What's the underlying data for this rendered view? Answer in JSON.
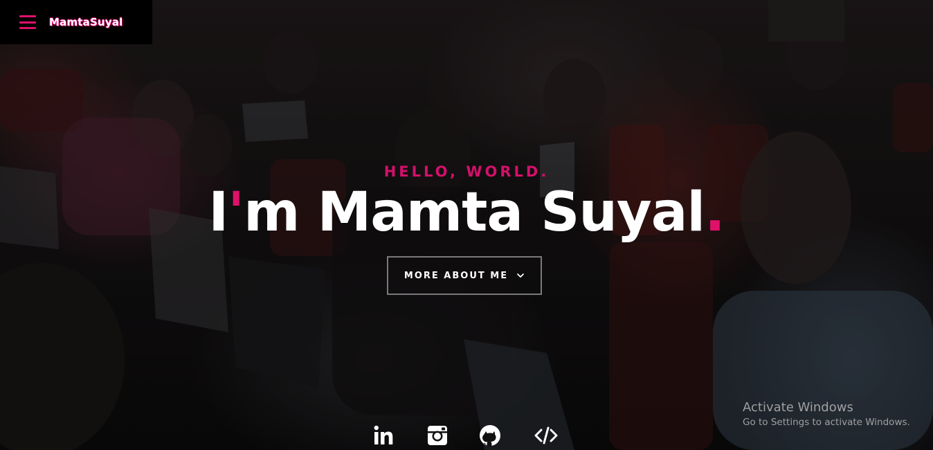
{
  "brand": {
    "name": "MamtaSuyal",
    "accent_color": "#e0116b"
  },
  "menu": {
    "icon": "hamburger-menu-icon"
  },
  "hero": {
    "greeting": "HELLO, WORLD.",
    "headline_prefix_i": "I",
    "headline_apostrophe": "'",
    "headline_rest": "m Mamta Suyal",
    "headline_period": ".",
    "cta_label": "MORE ABOUT ME",
    "cta_icon": "chevron-down-icon"
  },
  "social": [
    {
      "name": "linkedin",
      "icon": "linkedin-icon"
    },
    {
      "name": "instagram",
      "icon": "instagram-icon"
    },
    {
      "name": "github",
      "icon": "github-icon"
    },
    {
      "name": "code",
      "icon": "code-icon"
    }
  ],
  "watermark": {
    "title": "Activate Windows",
    "subtitle": "Go to Settings to activate Windows."
  }
}
